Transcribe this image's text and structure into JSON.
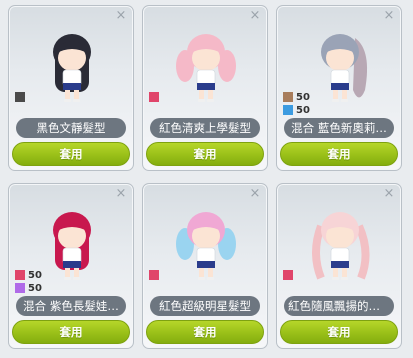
{
  "close_glyph": "×",
  "cards": [
    {
      "name": "黑色文靜髮型",
      "apply_label": "套用",
      "hair_color": "#2a2b36",
      "hair_color2": "#2a2b36",
      "swatches": [
        {
          "color": "#4a4a4a",
          "percent": ""
        }
      ]
    },
    {
      "name": "紅色清爽上學髮型",
      "apply_label": "套用",
      "hair_color": "#f5b9c8",
      "hair_color2": "#f5b9c8",
      "swatches": [
        {
          "color": "#e0456a",
          "percent": ""
        }
      ]
    },
    {
      "name": "混合  藍色新奧莉…",
      "apply_label": "套用",
      "hair_color": "#9aa3b6",
      "hair_color2": "#b8a8b4",
      "swatches": [
        {
          "color": "#a87d5c",
          "percent": "50"
        },
        {
          "color": "#3c9be0",
          "percent": "50"
        }
      ]
    },
    {
      "name": "混合  紫色長髮娃…",
      "apply_label": "套用",
      "hair_color": "#c8184e",
      "hair_color2": "#a01244",
      "swatches": [
        {
          "color": "#e0456a",
          "percent": "50"
        },
        {
          "color": "#b06ae8",
          "percent": "50"
        }
      ]
    },
    {
      "name": "紅色超級明星髮型",
      "apply_label": "套用",
      "hair_color": "#f0a8d4",
      "hair_color2": "#9ad4f0",
      "swatches": [
        {
          "color": "#e0456a",
          "percent": ""
        }
      ]
    },
    {
      "name": "紅色隨風飄揚的鄉…",
      "apply_label": "套用",
      "hair_color": "#f7d4d6",
      "hair_color2": "#f2c0c4",
      "swatches": [
        {
          "color": "#e0456a",
          "percent": ""
        }
      ]
    }
  ]
}
